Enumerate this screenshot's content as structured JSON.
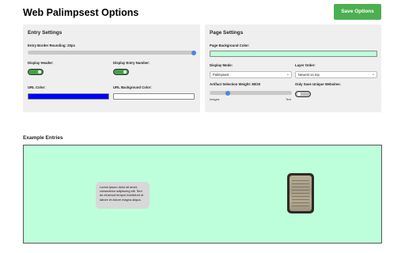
{
  "header": {
    "title": "Web Palimpsest Options",
    "save_label": "Save Options"
  },
  "entry_settings": {
    "title": "Entry Settings",
    "border_rounding_label": "Entry Border Rounding:  20px",
    "border_rounding_value": 20,
    "display_header_label": "Display Header:",
    "display_header_on": true,
    "display_entry_number_label": "Display Entry Number:",
    "display_entry_number_on": true,
    "url_color_label": "URL Color:",
    "url_color": "#0000ff",
    "url_bg_color_label": "URL Background Color:",
    "url_bg_color": "#ffffff"
  },
  "page_settings": {
    "title": "Page Settings",
    "bg_color_label": "Page Background Color:",
    "bg_color": "#bdffdb",
    "display_mode_label": "Display Mode:",
    "display_mode_value": "Palimpsest",
    "layer_order_label": "Layer Order:",
    "layer_order_value": "Newest on top",
    "artifact_weight_label": "Artifact Selection Weight:  80/20",
    "artifact_weight_fraction": 0.2,
    "artifact_min_label": "Images",
    "artifact_max_label": "Text",
    "unique_sites_label": "Only Save Unique Websites:",
    "unique_sites_on": false
  },
  "example": {
    "title": "Example Entries",
    "text_entry": "Lorem ipsum dolor sit amet, consectetur adipiscing elit. Sed do eiusmod tempor incididunt ut labore et dolore magna aliqua."
  },
  "colors": {
    "accent": "#4caf50",
    "slider_thumb": "#4a86e8",
    "panel_bg": "#efefef"
  }
}
